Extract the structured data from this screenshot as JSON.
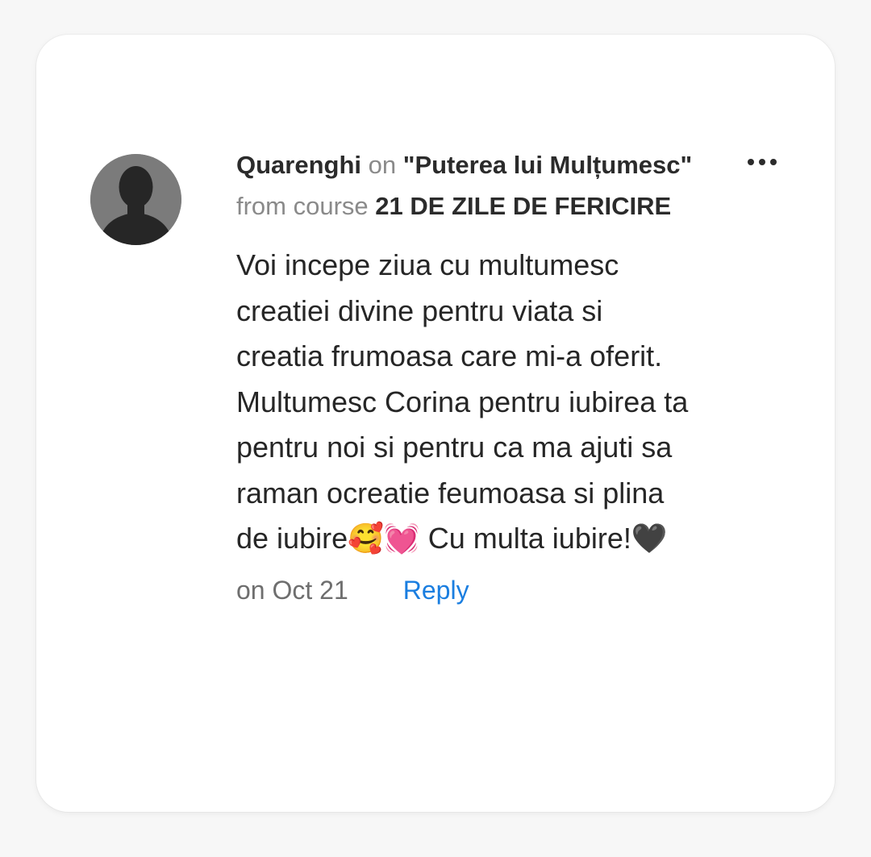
{
  "comment": {
    "author": "Quarenghi",
    "on_word": "on",
    "lesson_title": "\"Puterea lui Mulțumesc\"",
    "from_course_text": "from course",
    "course_title": "21 DE ZILE DE FERICIRE",
    "body": "Voi incepe ziua cu multumesc creatiei divine pentru viata si creatia frumoasa care mi-a oferit. Multumesc Corina pentru iubirea ta pentru noi si pentru ca ma ajuti sa raman ocreatie feumoasa si plina de iubire🥰💓 Cu multa iubire!🖤",
    "date": "on Oct 21",
    "reply_label": "Reply"
  },
  "icons": {
    "avatar": "default-user-silhouette",
    "menu": "more-horizontal-icon"
  },
  "colors": {
    "background": "#f7f7f7",
    "card": "#ffffff",
    "accent": "#1a7ee0",
    "muted": "#8a8a8a",
    "text": "#262626"
  }
}
